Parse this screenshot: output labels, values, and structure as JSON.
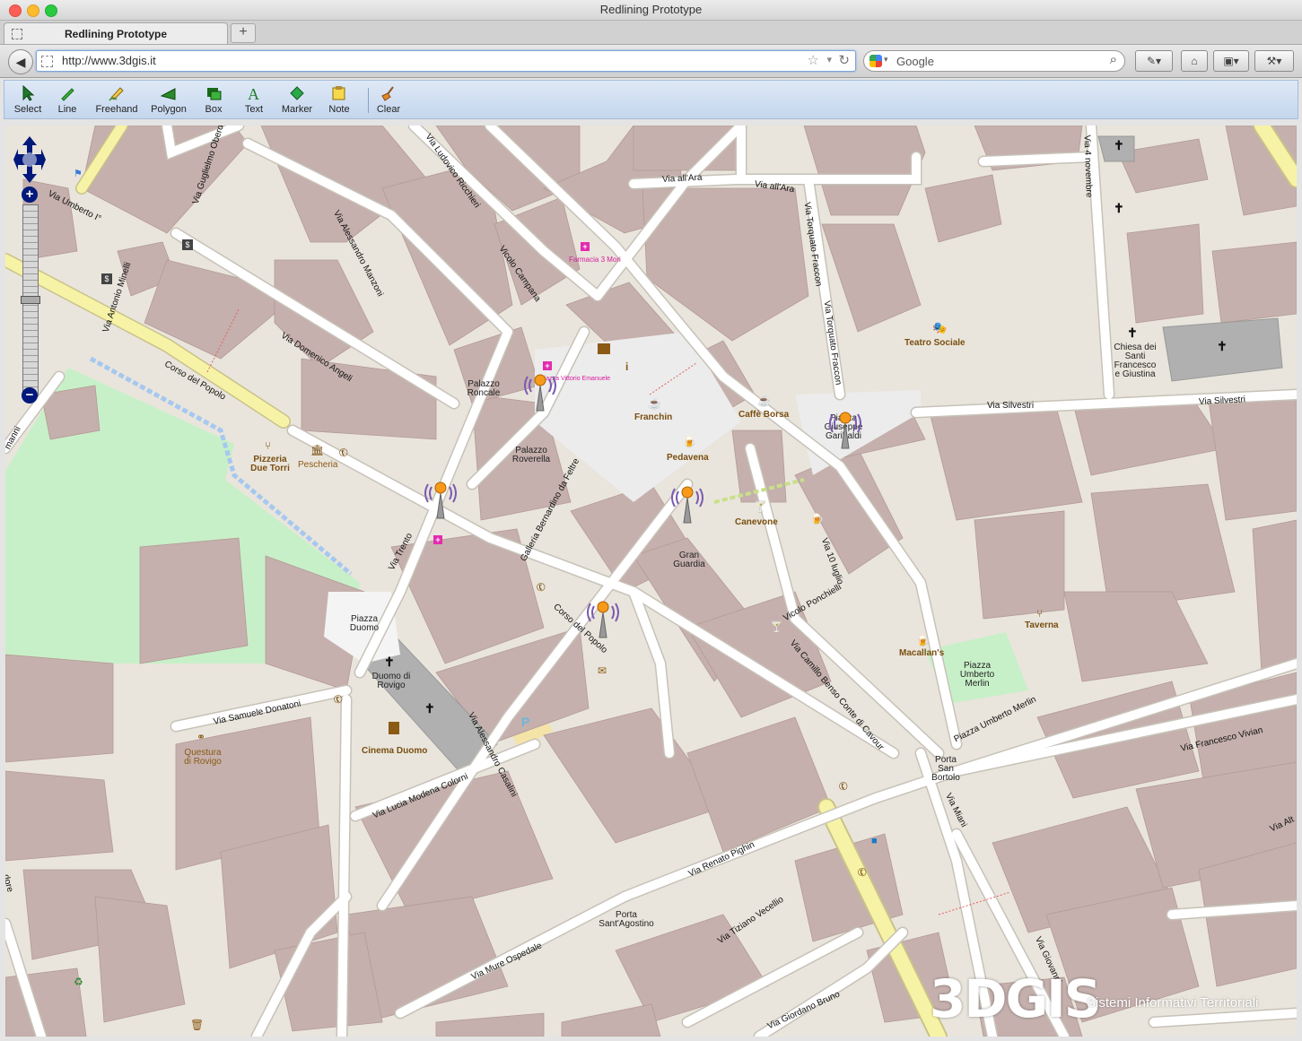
{
  "window": {
    "title": "Redlining Prototype"
  },
  "tabs": [
    {
      "title": "Redlining Prototype"
    }
  ],
  "navigation": {
    "url": "http://www.3dgis.it",
    "search_placeholder": "Google"
  },
  "toolbar": {
    "tools": [
      {
        "label": "Select",
        "icon": "arrow-cursor-icon"
      },
      {
        "label": "Line",
        "icon": "pencil-line-icon"
      },
      {
        "label": "Freehand",
        "icon": "freehand-pencil-icon"
      },
      {
        "label": "Polygon",
        "icon": "polygon-icon"
      },
      {
        "label": "Box",
        "icon": "box-icon"
      },
      {
        "label": "Text",
        "icon": "text-icon"
      },
      {
        "label": "Marker",
        "icon": "marker-icon"
      },
      {
        "label": "Note",
        "icon": "note-icon"
      },
      {
        "label": "Clear",
        "icon": "broom-icon"
      }
    ]
  },
  "map": {
    "colors": {
      "building": "#c5b0ad",
      "land": "#e9e5dc",
      "park": "#c8f0c8",
      "road_primary": "#f7f3a6",
      "road": "#ffffff",
      "church": "#b0b0b0",
      "parking": "#f4e4a8",
      "path": "#a6c8f0"
    },
    "streets": {
      "via_umberto": "Via Umberto I°",
      "via_guglielmo": "Via Guglielmo Oberdan",
      "via_ludovico": "Via Ludovico Ricchieri",
      "via_all_ara_1": "Via all'Ara",
      "via_all_ara_2": "Via all'Ara",
      "via_torquato_1": "Via Torquato Fraccon",
      "via_torquato_2": "Via Torquato Fraccon",
      "via_4_novembre": "Via 4 novembre",
      "via_manzoni": "Via Alessandro Manzoni",
      "vicolo_campana": "Vicolo Campana",
      "via_minelli": "Via Antonio Minelli",
      "corso_popolo": "Corso del Popolo",
      "via_angeli": "Via Domenico Angeli",
      "via_silvestri_1": "Via Silvestri",
      "via_silvestri_2": "Via Silvestri",
      "galleria": "Galleria Bernardino da Feltre",
      "via_trento": "Via Trento",
      "via_10_luglio": "Via 10 luglio",
      "corso_popolo_2": "Corso del Popolo",
      "via_ponchielli": "Vicolo Ponchielli",
      "via_cavour": "Via Camillo Benso Conte di Cavour",
      "via_donatoni": "Via Samuele Donatoni",
      "via_gasalini": "Via Alessandro Casalini",
      "via_colorni": "Via Lucia Modena Colorni",
      "piazza_merlin": "Piazza Umberto Merlin",
      "via_vivian": "Via Francesco Vivian",
      "via_miani": "Via Miani",
      "via_pighin": "Via Renato Pighin",
      "via_vecellio": "Via Tiziano Vecellio",
      "via_ospedale": "Via Mure Ospedale",
      "via_badaloni": "Via Nicola Badaloni",
      "via_bruno": "Via Giordano Bruno",
      "via_giovanni": "Via Giovanni",
      "via_alt": "Via Alt",
      "manni": "manni",
      "dore": "dore"
    },
    "places": {
      "farmacia": "Farmacia 3 Mori",
      "palazzo_roncale": "Palazzo Roncale",
      "palazzo_roverella": "Palazzo Roverella",
      "pizzeria": "Pizzeria Due Torri",
      "pescheria": "Pescheria",
      "franchin": "Franchin",
      "caffe_borsa": "Caffè Borsa",
      "pedavena": "Pedavena",
      "canevone": "Canevone",
      "gran_guardia": "Gran Guardia",
      "teatro": "Teatro Sociale",
      "chiesa": "Chiesa dei Santi Francesco e Giustina",
      "piazza_garibaldi": "Piazza Giuseppe Garibaldi",
      "piazza_duomo": "Piazza Duomo",
      "duomo": "Duomo di Rovigo",
      "cinema": "Cinema Duomo",
      "questura": "Questura di Rovigo",
      "taverna": "Taverna",
      "macallans": "Macallan's",
      "piazza_merlin": "Piazza Umberto Merlin",
      "porta_bortolo": "Porta San Bortolo",
      "porta_agostino": "Porta Sant'Agostino",
      "piazza_vittorio": "Piazza Vittorio Emanuele"
    },
    "zoom": {
      "plus": "+",
      "minus": "−"
    }
  },
  "watermark": {
    "logo": "3DGIS",
    "tagline": "Sistemi Informativi Territoriali"
  }
}
